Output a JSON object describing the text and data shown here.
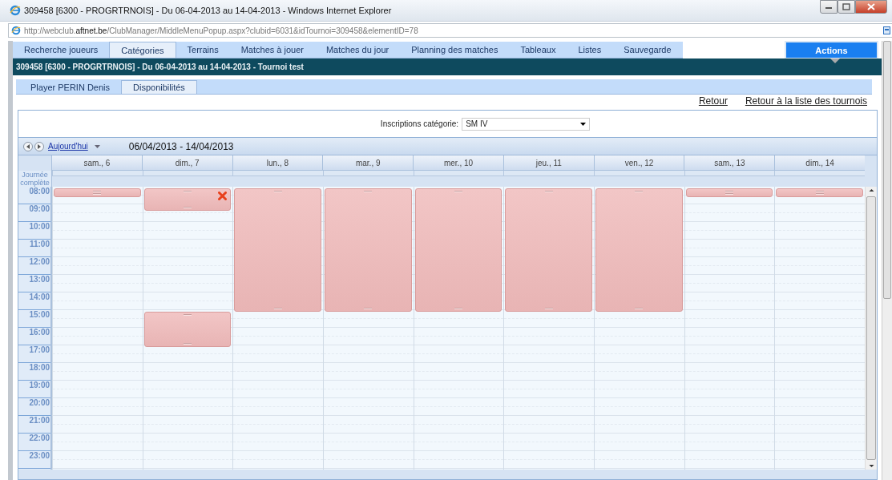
{
  "window": {
    "title": "309458 [6300 - PROGRTRNOIS] - Du 06-04-2013 au 14-04-2013 - Windows Internet Explorer",
    "url": "http://webclub.**aftnet.be**/ClubManager/MiddleMenuPopup.aspx?clubid=6031&idTournoi=309458&elementID=78"
  },
  "nav_tabs": [
    {
      "label": "Recherche joueurs",
      "selected": false
    },
    {
      "label": "Catégories",
      "selected": true
    },
    {
      "label": "Terrains",
      "selected": false
    },
    {
      "label": "Matches à jouer",
      "selected": false
    },
    {
      "label": "Matches du jour",
      "selected": false
    },
    {
      "label": "Planning des matches",
      "selected": false
    },
    {
      "label": "Tableaux",
      "selected": false
    },
    {
      "label": "Listes",
      "selected": false
    },
    {
      "label": "Sauvegarde",
      "selected": false
    }
  ],
  "actions_button": "Actions",
  "header_bar": "309458 [6300 - PROGRTRNOIS] - Du 06-04-2013 au 14-04-2013 - Tournoi test",
  "sub_tabs": [
    {
      "label": "Player PERIN Denis",
      "selected": false
    },
    {
      "label": "Disponibilités",
      "selected": true
    }
  ],
  "links": [
    "Retour",
    "Retour à la liste des tournois"
  ],
  "filter": {
    "label": "Inscriptions catégorie:",
    "value": "SM IV"
  },
  "calendar": {
    "today_link": "Aujourd'hui",
    "range": "06/04/2013 - 14/04/2013",
    "all_day_label": "Journée complète",
    "hours": [
      "08:00",
      "09:00",
      "10:00",
      "11:00",
      "12:00",
      "13:00",
      "14:00",
      "15:00",
      "16:00",
      "17:00",
      "18:00",
      "19:00",
      "20:00",
      "21:00",
      "22:00",
      "23:00"
    ],
    "days": [
      {
        "label": "sam., 6",
        "events": [
          {
            "kind": "short",
            "deletable": false
          }
        ]
      },
      {
        "label": "dim., 7",
        "events": [
          {
            "kind": "morning",
            "deletable": true
          },
          {
            "kind": "afternoon",
            "deletable": false
          }
        ]
      },
      {
        "label": "lun., 8",
        "events": [
          {
            "kind": "long",
            "deletable": false
          }
        ]
      },
      {
        "label": "mar., 9",
        "events": [
          {
            "kind": "long",
            "deletable": false
          }
        ]
      },
      {
        "label": "mer., 10",
        "events": [
          {
            "kind": "long",
            "deletable": false
          }
        ]
      },
      {
        "label": "jeu., 11",
        "events": [
          {
            "kind": "long",
            "deletable": false
          }
        ]
      },
      {
        "label": "ven., 12",
        "events": [
          {
            "kind": "long",
            "deletable": false
          }
        ]
      },
      {
        "label": "sam., 13",
        "events": [
          {
            "kind": "short",
            "deletable": false
          }
        ]
      },
      {
        "label": "dim., 14",
        "events": [
          {
            "kind": "short",
            "deletable": false
          }
        ]
      }
    ]
  }
}
